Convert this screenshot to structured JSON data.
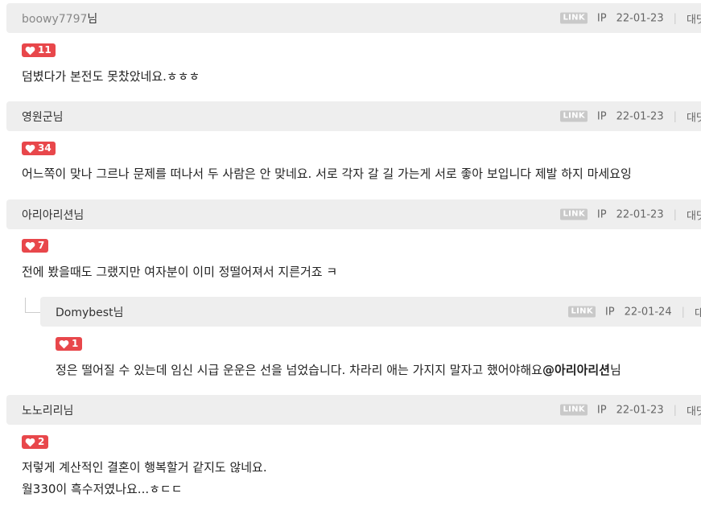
{
  "comments": [
    {
      "author": "boowy7797",
      "suffix": "님",
      "link": "LINK",
      "ip": "IP",
      "date": "22-01-23",
      "reply": "대댓",
      "likes": "11",
      "text": "덤볐다가 본전도 못찼았네요.ㅎㅎㅎ"
    },
    {
      "author": "영원군",
      "suffix": "님",
      "link": "LINK",
      "ip": "IP",
      "date": "22-01-23",
      "reply": "대댓",
      "likes": "34",
      "text": "어느쪽이 맞나 그르나 문제를 떠나서 두 사람은 안 맞네요. 서로 각자 갈 길 가는게 서로 좋아 보입니다 제발 하지 마세요잉"
    },
    {
      "author": "아리아리션",
      "suffix": "님",
      "link": "LINK",
      "ip": "IP",
      "date": "22-01-23",
      "reply": "대댓",
      "likes": "7",
      "text": "전에 봤을때도 그랬지만 여자분이 이미 정떨어져서 지른거죠 ㅋ"
    },
    {
      "author": "노노리리",
      "suffix": "님",
      "link": "LINK",
      "ip": "IP",
      "date": "22-01-23",
      "reply": "대댓",
      "likes": "2",
      "text1": "저렇게 계산적인 결혼이 행복할거 같지도 않네요.",
      "text2": "월330이 흑수저였나요...ㅎㄷㄷ"
    }
  ],
  "reply": {
    "author": "Domybest",
    "suffix": "님",
    "link": "LINK",
    "ip": "IP",
    "date": "22-01-24",
    "reply": "대댓",
    "likes": "1",
    "text": "정은 떨어질 수 있는데 임신 시급 운운은 선을 넘었습니다. 차라리 애는 가지지 말자고 했어야해요",
    "mention": "@아리아리션",
    "mention_suffix": "님"
  },
  "colors": {
    "like_bg": "#e8474b",
    "header_bg": "#eeeeee",
    "link_badge": "#c9c9c9"
  }
}
